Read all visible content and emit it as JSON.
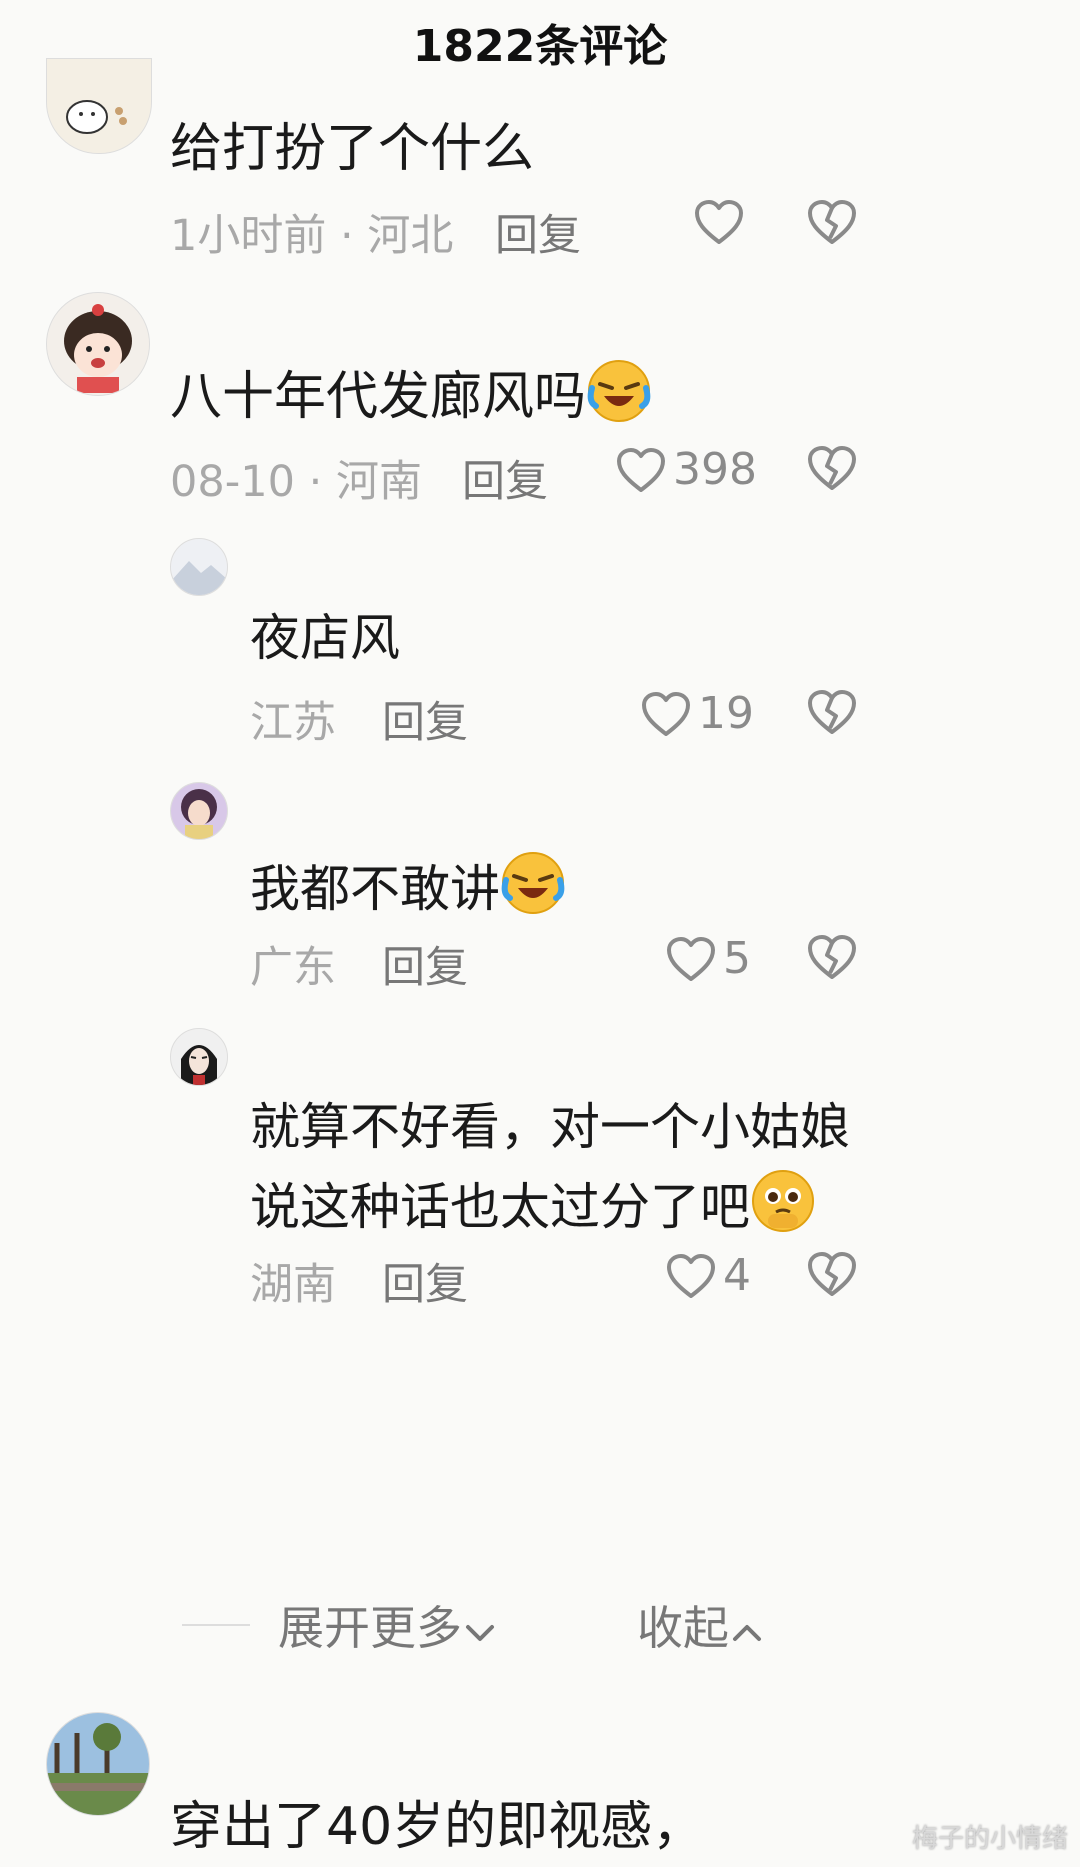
{
  "header": {
    "title": "1822条评论"
  },
  "comments": [
    {
      "text": "给打扮了个什么",
      "time": "1小时前",
      "location": "河北",
      "reply_label": "回复",
      "likes": ""
    },
    {
      "text": "八十年代发廊风吗",
      "emoji": "laugh-cry-emoji",
      "time": "08-10",
      "location": "河南",
      "reply_label": "回复",
      "likes": "398"
    },
    {
      "text": "夜店风",
      "location": "江苏",
      "reply_label": "回复",
      "likes": "19"
    },
    {
      "text": "我都不敢讲",
      "emoji": "laugh-cry-emoji",
      "location": "广东",
      "reply_label": "回复",
      "likes": "5"
    },
    {
      "text_line1": "就算不好看，对一个小姑娘",
      "text_line2": "说这种话也太过分了吧",
      "emoji": "pleading-emoji",
      "location": "湖南",
      "reply_label": "回复",
      "likes": "4"
    },
    {
      "text": "穿出了40岁的即视感，"
    }
  ],
  "separator": "·",
  "expand": {
    "more_label": "展开更多",
    "collapse_label": "收起"
  },
  "watermark": "梅子的小情绪",
  "colors": {
    "background": "#fafaf8",
    "meta": "#a8a8a8",
    "icon": "#8a8a8a"
  }
}
